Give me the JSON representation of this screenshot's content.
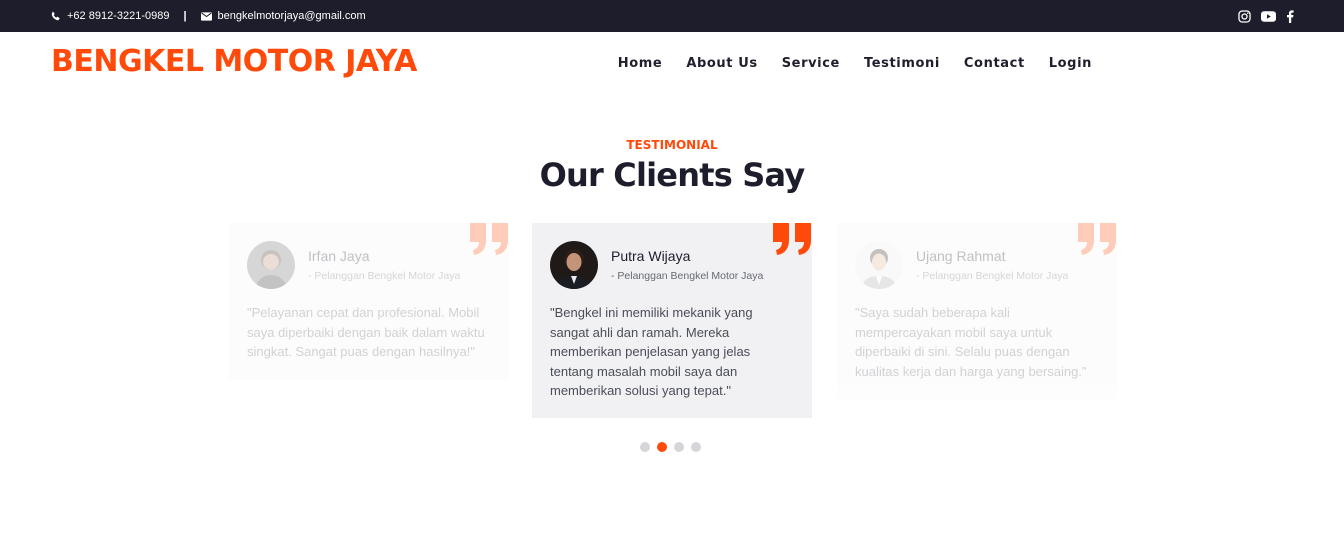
{
  "topbar": {
    "phone": "+62 8912-3221-0989",
    "separator": "|",
    "email": "bengkelmotorjaya@gmail.com",
    "social": [
      "instagram-icon",
      "youtube-icon",
      "facebook-icon"
    ]
  },
  "brand": "BENGKEL MOTOR JAYA",
  "nav": [
    "Home",
    "About Us",
    "Service",
    "Testimoni",
    "Contact",
    "Login"
  ],
  "section": {
    "eyebrow": "TESTIMONIAL",
    "heading": "Our Clients Say"
  },
  "testimonials": [
    {
      "name": "Irfan Jaya",
      "role": "- Pelanggan Bengkel Motor Jaya",
      "text": "\"Pelayanan cepat dan profesional. Mobil saya diperbaiki dengan baik dalam waktu singkat. Sangat puas dengan hasilnya!\""
    },
    {
      "name": "Putra Wijaya",
      "role": "- Pelanggan Bengkel Motor Jaya",
      "text": "\"Bengkel ini memiliki mekanik yang sangat ahli dan ramah. Mereka memberikan penjelasan yang jelas tentang masalah mobil saya dan memberikan solusi yang tepat.\""
    },
    {
      "name": "Ujang Rahmat",
      "role": "- Pelanggan Bengkel Motor Jaya",
      "text": "\"Saya sudah beberapa kali mempercayakan mobil saya untuk diperbaiki di sini. Selalu puas dengan kualitas kerja dan harga yang bersaing.\""
    }
  ],
  "carousel": {
    "dot_count": 4,
    "active_dot": 2
  },
  "colors": {
    "accent": "#ff4a0a",
    "topbar": "#1d1d2b",
    "card_active": "#f1f1f4"
  }
}
